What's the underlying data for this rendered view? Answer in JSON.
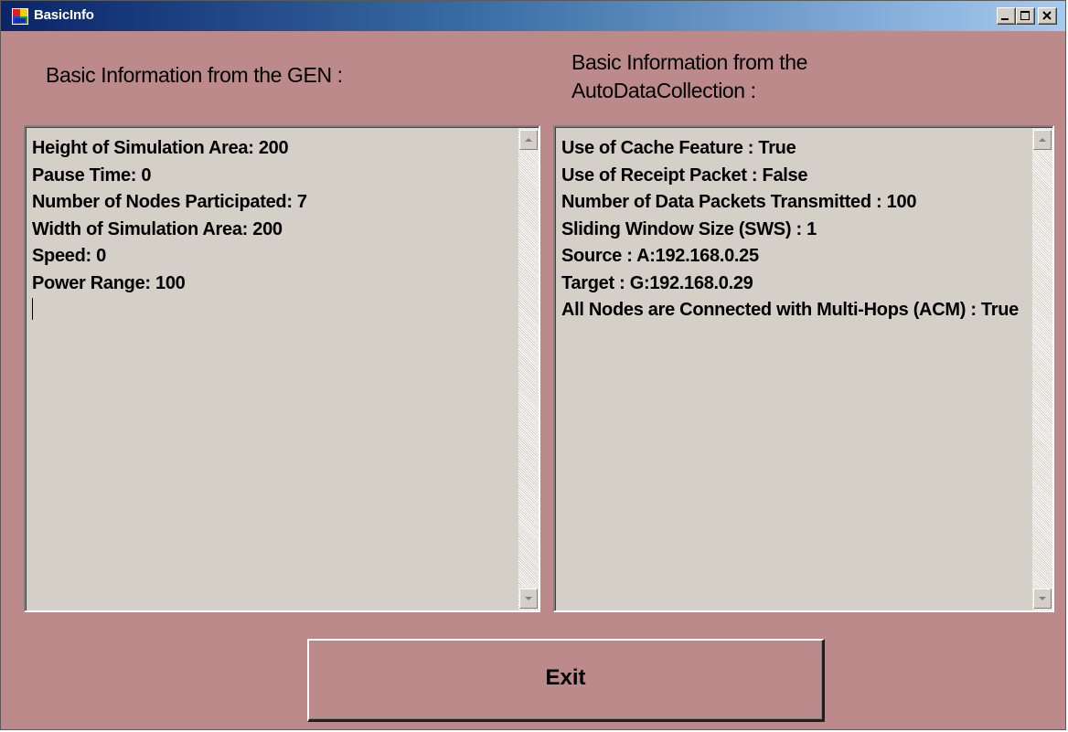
{
  "window": {
    "title": "BasicInfo",
    "icon": "app-window-icon",
    "controls": [
      "minimize-icon",
      "maximize-icon",
      "close-icon"
    ]
  },
  "headers": {
    "left": "Basic Information from the GEN :",
    "right_line1": "Basic Information from the",
    "right_line2": "AutoDataCollection :"
  },
  "left_panel": {
    "lines": [
      "Height of Simulation Area: 200",
      "Pause Time: 0",
      "Number of Nodes Participated: 7",
      "Width of Simulation Area: 200",
      "Speed: 0",
      "Power Range: 100"
    ]
  },
  "right_panel": {
    "lines": [
      "Use of Cache Feature : True",
      "Use of Receipt Packet : False",
      "Number of Data Packets Transmitted : 100",
      "Sliding Window Size (SWS) : 1",
      "Source : A:192.168.0.25",
      "Target : G:192.168.0.29",
      "All Nodes are Connected with Multi-Hops (ACM) : True"
    ]
  },
  "buttons": {
    "exit": "Exit"
  },
  "colors": {
    "form_background": "#bc8a8a",
    "textbox_background": "#d4d0c8",
    "titlebar_start": "#0a246a",
    "titlebar_end": "#a6caf0"
  }
}
